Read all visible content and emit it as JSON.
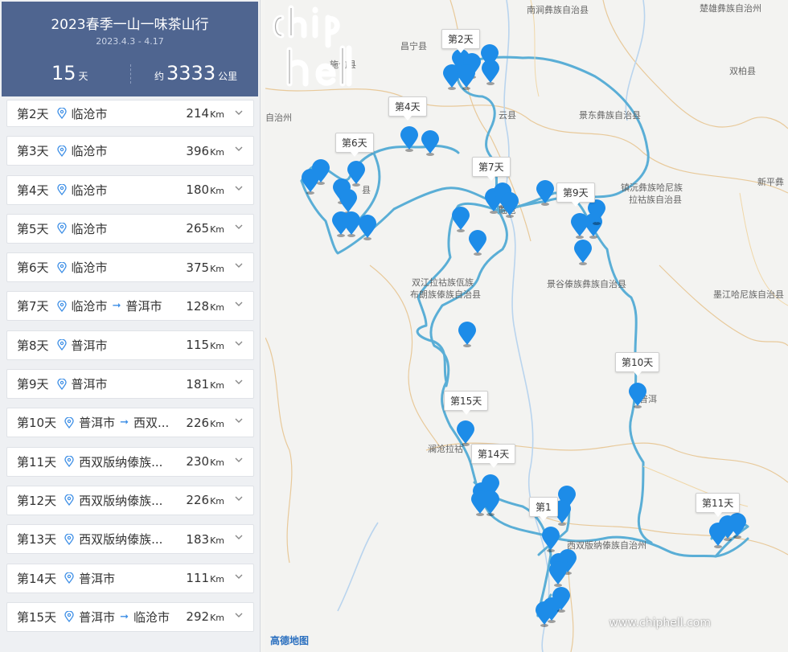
{
  "header": {
    "title": "2023春季一山一味茶山行",
    "dates": "2023.4.3 - 4.17",
    "days_value": "15",
    "days_unit": "天",
    "dist_prefix": "约",
    "dist_value": "3333",
    "dist_unit": "公里"
  },
  "days": [
    {
      "day": "第2天",
      "from": "临沧市",
      "to": "",
      "km": "214",
      "unit": "Km"
    },
    {
      "day": "第3天",
      "from": "临沧市",
      "to": "",
      "km": "396",
      "unit": "Km"
    },
    {
      "day": "第4天",
      "from": "临沧市",
      "to": "",
      "km": "180",
      "unit": "Km"
    },
    {
      "day": "第5天",
      "from": "临沧市",
      "to": "",
      "km": "265",
      "unit": "Km"
    },
    {
      "day": "第6天",
      "from": "临沧市",
      "to": "",
      "km": "375",
      "unit": "Km"
    },
    {
      "day": "第7天",
      "from": "临沧市",
      "to": "普洱市",
      "km": "128",
      "unit": "Km"
    },
    {
      "day": "第8天",
      "from": "普洱市",
      "to": "",
      "km": "115",
      "unit": "Km"
    },
    {
      "day": "第9天",
      "from": "普洱市",
      "to": "",
      "km": "181",
      "unit": "Km"
    },
    {
      "day": "第10天",
      "from": "普洱市",
      "to": "西双...",
      "km": "226",
      "unit": "Km"
    },
    {
      "day": "第11天",
      "from": "西双版纳傣族...",
      "to": "",
      "km": "230",
      "unit": "Km"
    },
    {
      "day": "第12天",
      "from": "西双版纳傣族...",
      "to": "",
      "km": "226",
      "unit": "Km"
    },
    {
      "day": "第13天",
      "from": "西双版纳傣族...",
      "to": "",
      "km": "183",
      "unit": "Km"
    },
    {
      "day": "第14天",
      "from": "普洱市",
      "to": "",
      "km": "111",
      "unit": "Km"
    },
    {
      "day": "第15天",
      "from": "普洱市",
      "to": "临沧市",
      "km": "292",
      "unit": "Km"
    }
  ],
  "map": {
    "labels": [
      {
        "text": "南涧彝族自治县"
      },
      {
        "text": "楚雄彝族自治州"
      },
      {
        "text": "昌宁县"
      },
      {
        "text": "施甸县"
      },
      {
        "text": "双柏县"
      },
      {
        "text": "云县"
      },
      {
        "text": "景东彝族自治县"
      },
      {
        "text": "自治州"
      },
      {
        "text": "镇沅彝族哈尼族"
      },
      {
        "text": "拉祜族自治县"
      },
      {
        "text": "新平彝"
      },
      {
        "text": "双江拉祜族佤族"
      },
      {
        "text": "布朗族傣族自治县"
      },
      {
        "text": "景谷傣族彝族自治县"
      },
      {
        "text": "墨江哈尼族自治县"
      },
      {
        "text": "普洱"
      },
      {
        "text": "澜沧拉祜"
      },
      {
        "text": "西双版纳傣族自治州"
      },
      {
        "text": "县"
      },
      {
        "text": "临沧"
      }
    ],
    "day_tips": [
      "第2天",
      "第4天",
      "第6天",
      "第7天",
      "第9天",
      "第10天",
      "第15天",
      "第14天",
      "第1",
      "第11天"
    ],
    "provider": "高德地图",
    "watermark": "www.chiphell.com",
    "logo_text": "chip hell"
  },
  "colors": {
    "header_bg": "#4f6590",
    "route": "#5aaed6",
    "marker": "#1d8ce8",
    "pin_icon": "#3c8ee6"
  }
}
